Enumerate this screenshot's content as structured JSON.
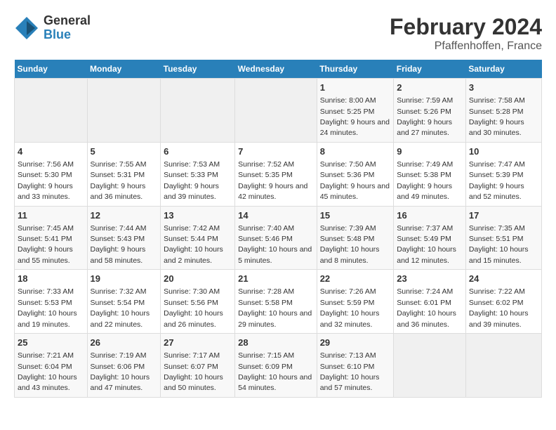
{
  "header": {
    "logo_general": "General",
    "logo_blue": "Blue",
    "main_title": "February 2024",
    "subtitle": "Pfaffenhoffen, France"
  },
  "days_of_week": [
    "Sunday",
    "Monday",
    "Tuesday",
    "Wednesday",
    "Thursday",
    "Friday",
    "Saturday"
  ],
  "weeks": [
    [
      {
        "day": "",
        "empty": true
      },
      {
        "day": "",
        "empty": true
      },
      {
        "day": "",
        "empty": true
      },
      {
        "day": "",
        "empty": true
      },
      {
        "day": "1",
        "sunrise": "Sunrise: 8:00 AM",
        "sunset": "Sunset: 5:25 PM",
        "daylight": "Daylight: 9 hours and 24 minutes."
      },
      {
        "day": "2",
        "sunrise": "Sunrise: 7:59 AM",
        "sunset": "Sunset: 5:26 PM",
        "daylight": "Daylight: 9 hours and 27 minutes."
      },
      {
        "day": "3",
        "sunrise": "Sunrise: 7:58 AM",
        "sunset": "Sunset: 5:28 PM",
        "daylight": "Daylight: 9 hours and 30 minutes."
      }
    ],
    [
      {
        "day": "4",
        "sunrise": "Sunrise: 7:56 AM",
        "sunset": "Sunset: 5:30 PM",
        "daylight": "Daylight: 9 hours and 33 minutes."
      },
      {
        "day": "5",
        "sunrise": "Sunrise: 7:55 AM",
        "sunset": "Sunset: 5:31 PM",
        "daylight": "Daylight: 9 hours and 36 minutes."
      },
      {
        "day": "6",
        "sunrise": "Sunrise: 7:53 AM",
        "sunset": "Sunset: 5:33 PM",
        "daylight": "Daylight: 9 hours and 39 minutes."
      },
      {
        "day": "7",
        "sunrise": "Sunrise: 7:52 AM",
        "sunset": "Sunset: 5:35 PM",
        "daylight": "Daylight: 9 hours and 42 minutes."
      },
      {
        "day": "8",
        "sunrise": "Sunrise: 7:50 AM",
        "sunset": "Sunset: 5:36 PM",
        "daylight": "Daylight: 9 hours and 45 minutes."
      },
      {
        "day": "9",
        "sunrise": "Sunrise: 7:49 AM",
        "sunset": "Sunset: 5:38 PM",
        "daylight": "Daylight: 9 hours and 49 minutes."
      },
      {
        "day": "10",
        "sunrise": "Sunrise: 7:47 AM",
        "sunset": "Sunset: 5:39 PM",
        "daylight": "Daylight: 9 hours and 52 minutes."
      }
    ],
    [
      {
        "day": "11",
        "sunrise": "Sunrise: 7:45 AM",
        "sunset": "Sunset: 5:41 PM",
        "daylight": "Daylight: 9 hours and 55 minutes."
      },
      {
        "day": "12",
        "sunrise": "Sunrise: 7:44 AM",
        "sunset": "Sunset: 5:43 PM",
        "daylight": "Daylight: 9 hours and 58 minutes."
      },
      {
        "day": "13",
        "sunrise": "Sunrise: 7:42 AM",
        "sunset": "Sunset: 5:44 PM",
        "daylight": "Daylight: 10 hours and 2 minutes."
      },
      {
        "day": "14",
        "sunrise": "Sunrise: 7:40 AM",
        "sunset": "Sunset: 5:46 PM",
        "daylight": "Daylight: 10 hours and 5 minutes."
      },
      {
        "day": "15",
        "sunrise": "Sunrise: 7:39 AM",
        "sunset": "Sunset: 5:48 PM",
        "daylight": "Daylight: 10 hours and 8 minutes."
      },
      {
        "day": "16",
        "sunrise": "Sunrise: 7:37 AM",
        "sunset": "Sunset: 5:49 PM",
        "daylight": "Daylight: 10 hours and 12 minutes."
      },
      {
        "day": "17",
        "sunrise": "Sunrise: 7:35 AM",
        "sunset": "Sunset: 5:51 PM",
        "daylight": "Daylight: 10 hours and 15 minutes."
      }
    ],
    [
      {
        "day": "18",
        "sunrise": "Sunrise: 7:33 AM",
        "sunset": "Sunset: 5:53 PM",
        "daylight": "Daylight: 10 hours and 19 minutes."
      },
      {
        "day": "19",
        "sunrise": "Sunrise: 7:32 AM",
        "sunset": "Sunset: 5:54 PM",
        "daylight": "Daylight: 10 hours and 22 minutes."
      },
      {
        "day": "20",
        "sunrise": "Sunrise: 7:30 AM",
        "sunset": "Sunset: 5:56 PM",
        "daylight": "Daylight: 10 hours and 26 minutes."
      },
      {
        "day": "21",
        "sunrise": "Sunrise: 7:28 AM",
        "sunset": "Sunset: 5:58 PM",
        "daylight": "Daylight: 10 hours and 29 minutes."
      },
      {
        "day": "22",
        "sunrise": "Sunrise: 7:26 AM",
        "sunset": "Sunset: 5:59 PM",
        "daylight": "Daylight: 10 hours and 32 minutes."
      },
      {
        "day": "23",
        "sunrise": "Sunrise: 7:24 AM",
        "sunset": "Sunset: 6:01 PM",
        "daylight": "Daylight: 10 hours and 36 minutes."
      },
      {
        "day": "24",
        "sunrise": "Sunrise: 7:22 AM",
        "sunset": "Sunset: 6:02 PM",
        "daylight": "Daylight: 10 hours and 39 minutes."
      }
    ],
    [
      {
        "day": "25",
        "sunrise": "Sunrise: 7:21 AM",
        "sunset": "Sunset: 6:04 PM",
        "daylight": "Daylight: 10 hours and 43 minutes."
      },
      {
        "day": "26",
        "sunrise": "Sunrise: 7:19 AM",
        "sunset": "Sunset: 6:06 PM",
        "daylight": "Daylight: 10 hours and 47 minutes."
      },
      {
        "day": "27",
        "sunrise": "Sunrise: 7:17 AM",
        "sunset": "Sunset: 6:07 PM",
        "daylight": "Daylight: 10 hours and 50 minutes."
      },
      {
        "day": "28",
        "sunrise": "Sunrise: 7:15 AM",
        "sunset": "Sunset: 6:09 PM",
        "daylight": "Daylight: 10 hours and 54 minutes."
      },
      {
        "day": "29",
        "sunrise": "Sunrise: 7:13 AM",
        "sunset": "Sunset: 6:10 PM",
        "daylight": "Daylight: 10 hours and 57 minutes."
      },
      {
        "day": "",
        "empty": true
      },
      {
        "day": "",
        "empty": true
      }
    ]
  ]
}
